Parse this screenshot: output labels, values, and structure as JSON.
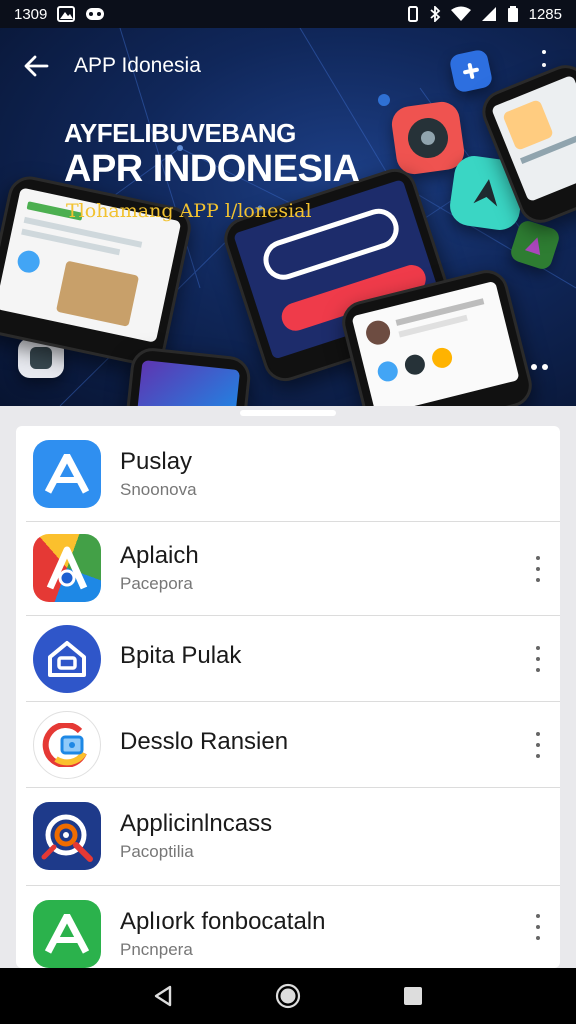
{
  "status_bar": {
    "time": "1309",
    "right_time": "1285",
    "icons_left": [
      "gallery-icon",
      "gamepad-icon"
    ],
    "icons_right": [
      "vibrate-icon",
      "bluetooth-icon",
      "wifi-icon",
      "signal-icon",
      "battery-icon"
    ]
  },
  "header": {
    "title": "APP Idonesia",
    "back_icon": "arrow-left-icon",
    "menu_icon": "more-vert-icon"
  },
  "banner": {
    "line1": "AYFELIBUVEBANG",
    "line2": "APR INDONESIA",
    "line3": "Tlohamang APP l/lonesial"
  },
  "apps": [
    {
      "name": "Puslay",
      "subtitle": "Snoonova",
      "has_menu": false,
      "icon_color": "#2f8ff0"
    },
    {
      "name": "Aplaich",
      "subtitle": "Pacepora",
      "has_menu": true,
      "icon_color": "#e53935"
    },
    {
      "name": "Bpita Pulak",
      "subtitle": "",
      "has_menu": true,
      "icon_color": "#2f56c9"
    },
    {
      "name": "Desslo Ransien",
      "subtitle": "",
      "has_menu": true,
      "icon_color": "#ffffff"
    },
    {
      "name": "Applicinlncass",
      "subtitle": "Pacoptilia",
      "has_menu": false,
      "icon_color": "#1e3a8a"
    },
    {
      "name": "Aplıork fonbocataln",
      "subtitle": "Pncnpera",
      "has_menu": true,
      "icon_color": "#2bb24c"
    }
  ],
  "navbar": {
    "back": "triangle-back-icon",
    "home": "circle-home-icon",
    "recents": "square-recents-icon"
  }
}
